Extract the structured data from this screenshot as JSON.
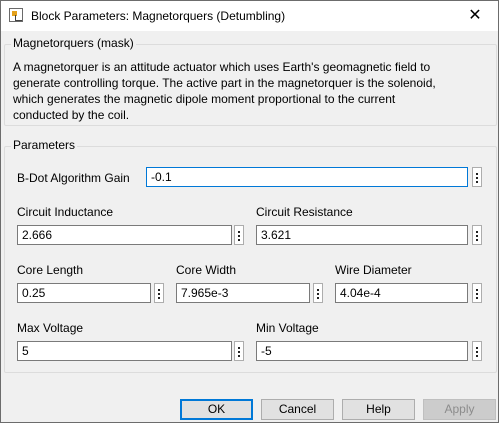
{
  "window": {
    "title": "Block Parameters: Magnetorquers (Detumbling)",
    "close_glyph": "✕"
  },
  "mask": {
    "heading": "Magnetorquers (mask)",
    "lines": [
      "A magnetorquer is an attitude actuator which uses Earth's geomagnetic field to",
      "generate controlling torque. The active part in the magnetorquer is the solenoid,",
      "which generates the magnetic dipole moment proportional to the current",
      "conducted by the coil."
    ]
  },
  "parameters": {
    "heading": "Parameters",
    "bdot_gain": {
      "label": "B-Dot Algorithm Gain",
      "value": "-0.1"
    },
    "circuit_inductance": {
      "label": "Circuit Inductance",
      "value": "2.666"
    },
    "circuit_resistance": {
      "label": "Circuit Resistance",
      "value": "3.621"
    },
    "core_length": {
      "label": "Core Length",
      "value": "0.25"
    },
    "core_width": {
      "label": "Core Width",
      "value": "7.965e-3"
    },
    "wire_diameter": {
      "label": "Wire Diameter",
      "value": "4.04e-4"
    },
    "max_voltage": {
      "label": "Max Voltage",
      "value": "5"
    },
    "min_voltage": {
      "label": "Min Voltage",
      "value": "-5"
    }
  },
  "buttons": {
    "ok": "OK",
    "cancel": "Cancel",
    "help": "Help",
    "apply": "Apply"
  },
  "colors": {
    "accent": "#0078d7",
    "background": "#f0f0f0"
  }
}
